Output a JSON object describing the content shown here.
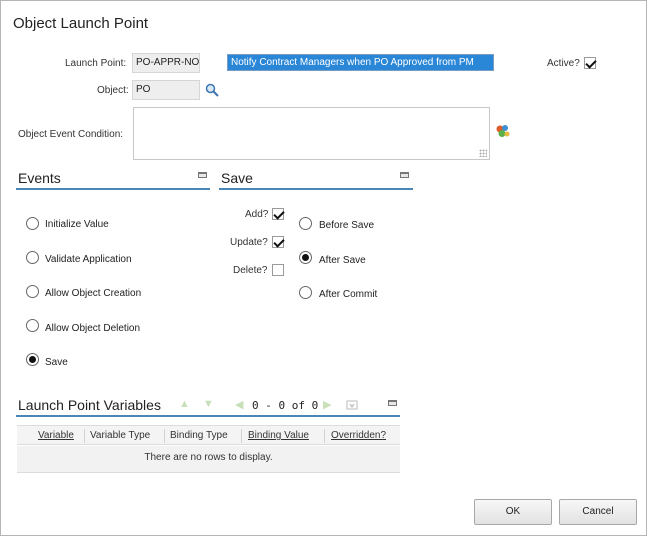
{
  "dialog": {
    "title": "Object Launch Point"
  },
  "form": {
    "launch_point_label": "Launch Point:",
    "launch_point_value": "PO-APPR-NO",
    "description_value": "Notify Contract Managers when PO Approved from PM",
    "active_label": "Active?",
    "active_checked": true,
    "object_label": "Object:",
    "object_value": "PO",
    "event_condition_label": "Object Event Condition:",
    "event_condition_value": ""
  },
  "events": {
    "heading": "Events",
    "options": [
      {
        "label": "Initialize Value",
        "checked": false
      },
      {
        "label": "Validate Application",
        "checked": false
      },
      {
        "label": "Allow Object Creation",
        "checked": false
      },
      {
        "label": "Allow Object Deletion",
        "checked": false
      },
      {
        "label": "Save",
        "checked": true
      }
    ]
  },
  "save": {
    "heading": "Save",
    "add_label": "Add?",
    "add_checked": true,
    "update_label": "Update?",
    "update_checked": true,
    "delete_label": "Delete?",
    "delete_checked": false,
    "timing_options": [
      {
        "label": "Before Save",
        "checked": false
      },
      {
        "label": "After Save",
        "checked": true
      },
      {
        "label": "After Commit",
        "checked": false
      }
    ]
  },
  "variables": {
    "heading": "Launch Point Variables",
    "pager_text": "0 - 0 of 0",
    "columns": [
      "Variable",
      "Variable Type",
      "Binding Type",
      "Binding Value",
      "Overridden?"
    ],
    "empty_message": "There are no rows to display."
  },
  "buttons": {
    "ok": "OK",
    "cancel": "Cancel"
  },
  "colors": {
    "section_rule": "#4a86b8",
    "selection_highlight": "#2a86d6"
  },
  "icons": [
    "magnifier-icon",
    "condition-builder-icon",
    "minimize-icon",
    "arrow-first-icon",
    "arrow-prev-icon",
    "arrow-next-icon",
    "arrow-last-icon",
    "download-icon"
  ]
}
